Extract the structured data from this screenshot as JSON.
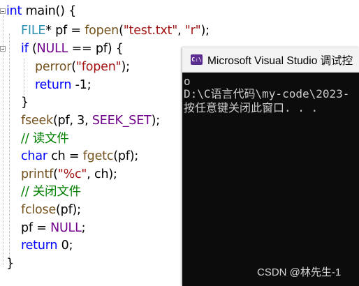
{
  "editor": {
    "line1": {
      "type": "int",
      "rest": " main() {"
    },
    "line2": {
      "type": "FILE",
      "mid": "* pf = ",
      "func": "fopen",
      "open": "(",
      "arg1": "\"test.txt\"",
      "sep": ", ",
      "arg2": "\"r\"",
      "close": ");"
    },
    "line3": {
      "kw": "if",
      "open": " (",
      "macro": "NULL",
      "rest": " == pf) {"
    },
    "line4": {
      "func": "perror",
      "open": "(",
      "arg": "\"fopen\"",
      "close": ");"
    },
    "line5": {
      "kw": "return",
      "rest": " -1;"
    },
    "line6": {
      "text": "}"
    },
    "line7": {
      "func": "fseek",
      "mid": "(pf, 3, ",
      "macro": "SEEK_SET",
      "close": ");"
    },
    "line8": {
      "comment": "// 读文件"
    },
    "line9": {
      "type": "char",
      "mid": " ch = ",
      "func": "fgetc",
      "close": "(pf);"
    },
    "line10": {
      "func": "printf",
      "open": "(",
      "arg": "\"%c\"",
      "close": ", ch);"
    },
    "line11": {
      "comment": "// 关闭文件"
    },
    "line12": {
      "func": "fclose",
      "close": "(pf);"
    },
    "line13": {
      "mid": "pf = ",
      "macro": "NULL",
      "close": ";"
    },
    "line14": {
      "kw": "return",
      "rest": " 0;"
    },
    "line15": {
      "text": "}"
    }
  },
  "console": {
    "icon_text": "C:\\",
    "title": "Microsoft Visual Studio 调试控",
    "output": [
      "o",
      "D:\\C语言代码\\my-code\\2023-",
      "按任意键关闭此窗口. . ."
    ]
  },
  "watermark": "CSDN @林先生-1",
  "colors": {
    "keyword": "#0000ff",
    "type": "#2b91af",
    "string": "#a31515",
    "macro": "#6f008a",
    "function": "#74531f",
    "comment": "#008000",
    "console_bg": "#0c0c0c",
    "console_text": "#cccccc",
    "vs_icon": "#5c2d91"
  }
}
